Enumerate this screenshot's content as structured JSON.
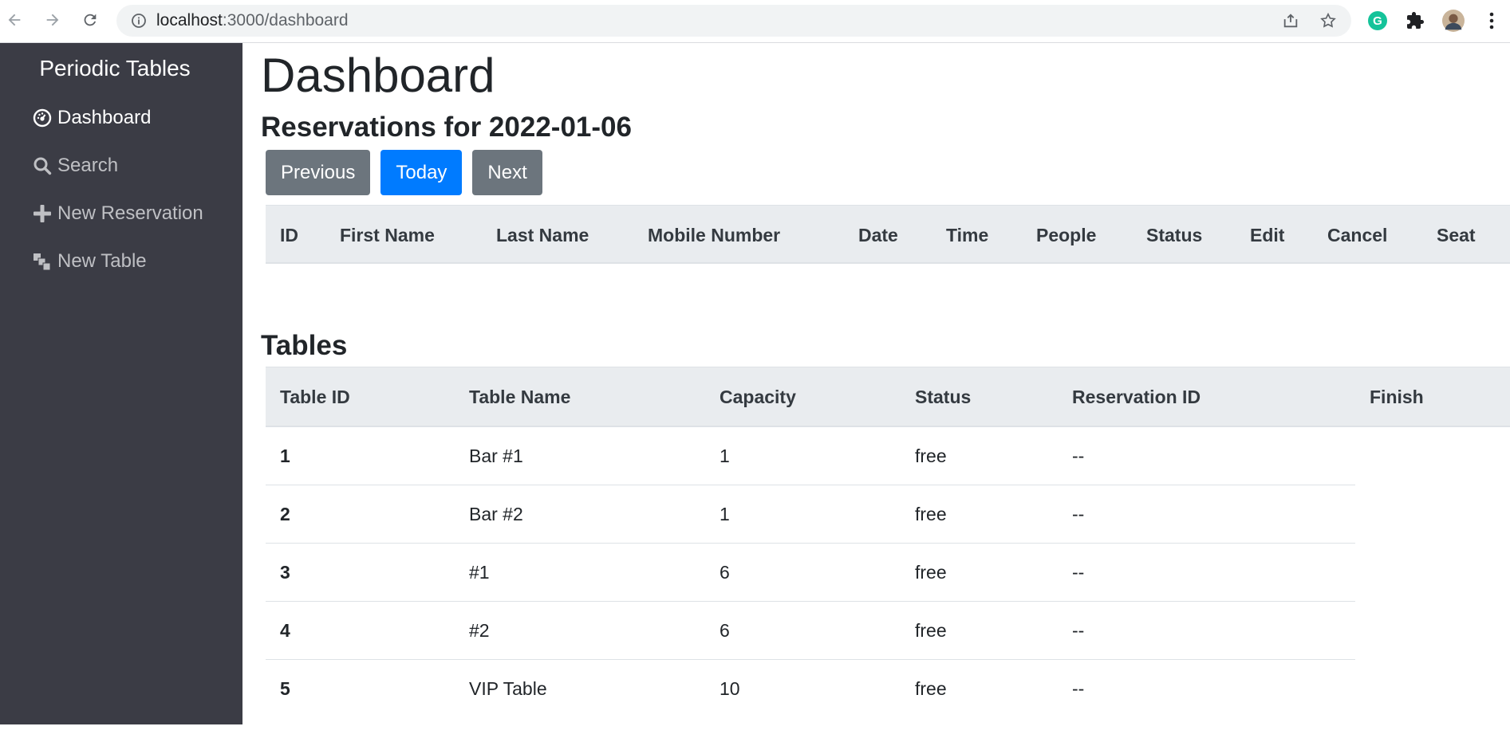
{
  "browser": {
    "url_host": "localhost",
    "url_path": ":3000/dashboard"
  },
  "sidebar": {
    "brand": "Periodic Tables",
    "items": [
      {
        "label": "Dashboard",
        "icon": "dashboard-icon",
        "active": true
      },
      {
        "label": "Search",
        "icon": "search-icon",
        "active": false
      },
      {
        "label": "New Reservation",
        "icon": "plus-icon",
        "active": false
      },
      {
        "label": "New Table",
        "icon": "layers-icon",
        "active": false
      }
    ]
  },
  "main": {
    "title": "Dashboard",
    "subtitle": "Reservations for 2022-01-06",
    "buttons": {
      "previous": "Previous",
      "today": "Today",
      "next": "Next"
    },
    "reservations_headers": [
      "ID",
      "First Name",
      "Last Name",
      "Mobile Number",
      "Date",
      "Time",
      "People",
      "Status",
      "Edit",
      "Cancel",
      "Seat"
    ],
    "tables_title": "Tables",
    "tables_headers": [
      "Table ID",
      "Table Name",
      "Capacity",
      "Status",
      "Reservation ID",
      "Finish"
    ],
    "tables_rows": [
      {
        "id": "1",
        "name": "Bar #1",
        "capacity": "1",
        "status": "free",
        "reservation_id": "--"
      },
      {
        "id": "2",
        "name": "Bar #2",
        "capacity": "1",
        "status": "free",
        "reservation_id": "--"
      },
      {
        "id": "3",
        "name": "#1",
        "capacity": "6",
        "status": "free",
        "reservation_id": "--"
      },
      {
        "id": "4",
        "name": "#2",
        "capacity": "6",
        "status": "free",
        "reservation_id": "--"
      },
      {
        "id": "5",
        "name": "VIP Table",
        "capacity": "10",
        "status": "free",
        "reservation_id": "--"
      }
    ]
  },
  "colors": {
    "sidebar_bg": "#3b3c45",
    "primary": "#007bff",
    "secondary": "#6c757d",
    "table_head_bg": "#e9ecef"
  }
}
